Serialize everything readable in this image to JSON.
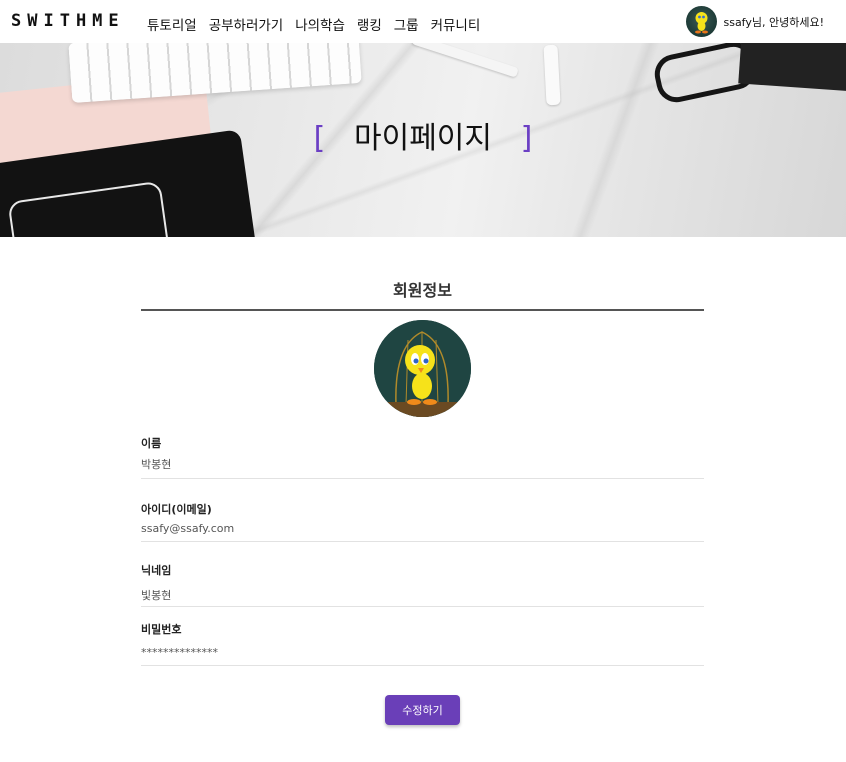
{
  "brand": {
    "logo": "SWITHME",
    "accent": "#6a3fb8"
  },
  "nav": {
    "items": [
      "튜토리얼",
      "공부하러가기",
      "나의학습",
      "랭킹",
      "그룹",
      "커뮤니티"
    ],
    "greeting": "ssafy님, 안녕하세요!"
  },
  "hero": {
    "bracket_left": "[",
    "title": "마이페이지",
    "bracket_right": "]"
  },
  "profile": {
    "section_title": "회원정보",
    "fields": [
      {
        "label": "이름",
        "value": "박봉현"
      },
      {
        "label": "아이디(이메일)",
        "value": "ssafy@ssafy.com"
      },
      {
        "label": "닉네임",
        "value": "빛봉현"
      },
      {
        "label": "비밀번호",
        "value": "**************"
      }
    ],
    "edit_button": "수정하기"
  }
}
